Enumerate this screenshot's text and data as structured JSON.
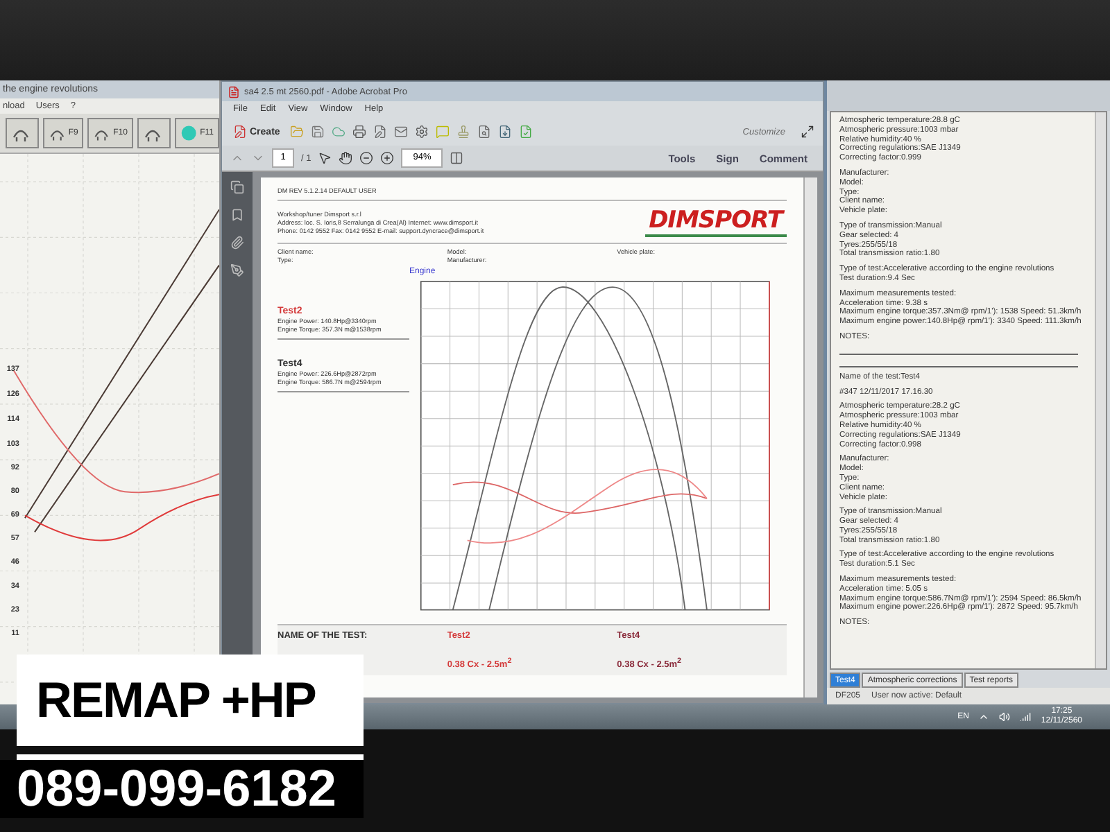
{
  "left_app": {
    "title": "the engine revolutions",
    "menu": [
      "nload",
      "Users",
      "?"
    ],
    "toolbar": [
      {
        "kind": "icon"
      },
      {
        "kind": "labeled",
        "label": "F9"
      },
      {
        "kind": "labeled",
        "label": "F10"
      },
      {
        "kind": "icon"
      },
      {
        "kind": "labeled",
        "label": "F11"
      }
    ],
    "y_ticks": [
      "137",
      "126",
      "114",
      "103",
      "92",
      "80",
      "69",
      "57",
      "46",
      "34",
      "23",
      "11"
    ]
  },
  "acrobat": {
    "title": "sa4 2.5 mt 2560.pdf - Adobe Acrobat Pro",
    "menu": [
      "File",
      "Edit",
      "View",
      "Window",
      "Help"
    ],
    "create": "Create",
    "customize": "Customize",
    "panels": [
      "Tools",
      "Sign",
      "Comment"
    ],
    "page": "1",
    "page_total": "/ 1",
    "zoom": "94%"
  },
  "document": {
    "header": "DM REV 5.1.2.14   DEFAULT USER",
    "workshop": [
      "Workshop/tuner Dimsport s.r.l",
      "Address: loc. S. Ioris,8 Serralunga di Crea(Al) Internet: www.dimsport.it",
      "Phone: 0142 9552 Fax: 0142 9552 E-mail: support.dyncrace@dimsport.it"
    ],
    "logo": "DIMSPORT",
    "info": [
      "Client name:",
      "Model:",
      "Vehicle plate:",
      "Type:",
      "Manufacturer:"
    ],
    "chart_title": "Engine",
    "tests": [
      {
        "name": "Test2",
        "color": "#d43a3a",
        "lines": [
          "Engine Power: 140.8Hp@3340rpm",
          "Engine Torque: 357.3N m@1538rpm"
        ]
      },
      {
        "name": "Test4",
        "color": "#333333",
        "lines": [
          "Engine Power: 226.6Hp@2872rpm",
          "Engine Torque: 586.7N m@2594rpm"
        ]
      }
    ],
    "table": {
      "label": "NAME OF THE TEST:",
      "tests": [
        {
          "name": "Test2",
          "value": "0.38 Cx - 2.5m$^{2}$",
          "color": "#d43a3a"
        },
        {
          "name": "Test4",
          "value": "0.38 Cx - 2.5m$^{2}$",
          "color": "#8a2a3a"
        }
      ]
    }
  },
  "report": {
    "blocks": [
      {
        "kind": "text",
        "lines": [
          "Atmospheric temperature:28.8 gC",
          "Atmospheric pressure:1003 mbar",
          "Relative humidity:40 %",
          "Correcting regulations:SAE J1349",
          "Correcting factor:0.999"
        ]
      },
      {
        "kind": "text",
        "lines": [
          "Manufacturer:",
          "Model:",
          "Type:",
          "Client name:",
          "Vehicle plate:"
        ]
      },
      {
        "kind": "text",
        "lines": [
          "Type of transmission:Manual",
          "Gear selected: 4",
          "Tyres:255/55/18",
          "Total transmission ratio:1.80"
        ]
      },
      {
        "kind": "text",
        "lines": [
          "Type of test:Accelerative according to the engine revolutions",
          "Test duration:9.4 Sec"
        ]
      },
      {
        "kind": "text",
        "lines": [
          "Maximum measurements tested:",
          "Acceleration time:  9.38 s",
          "Maximum engine torque:357.3Nm@ rpm/1'): 1538 Speed: 51.3km/h",
          "Maximum engine power:140.8Hp@ rpm/1'): 3340 Speed: 111.3km/h"
        ]
      },
      {
        "kind": "notes",
        "lines": [
          "NOTES:"
        ]
      },
      {
        "kind": "text",
        "lines": [
          "Name of the test:Test4"
        ]
      },
      {
        "kind": "text",
        "lines": [
          "#347    12/11/2017 17.16.30"
        ]
      },
      {
        "kind": "text",
        "lines": [
          "Atmospheric temperature:28.2 gC",
          "Atmospheric pressure:1003 mbar",
          "Relative humidity:40 %",
          "Correcting regulations:SAE J1349",
          "Correcting factor:0.998"
        ]
      },
      {
        "kind": "text",
        "lines": [
          "Manufacturer:",
          "Model:",
          "Type:",
          "Client name:",
          "Vehicle plate:"
        ]
      },
      {
        "kind": "text",
        "lines": [
          "Type of transmission:Manual",
          "Gear selected: 4",
          "Tyres:255/55/18",
          "Total transmission ratio:1.80"
        ]
      },
      {
        "kind": "text",
        "lines": [
          "Type of test:Accelerative according to the engine revolutions",
          "Test duration:5.1 Sec"
        ]
      },
      {
        "kind": "text",
        "lines": [
          "Maximum measurements tested:",
          "Acceleration time:  5.05 s",
          "Maximum engine torque:586.7Nm@ rpm/1'): 2594 Speed: 86.5km/h",
          "Maximum engine power:226.6Hp@ rpm/1'): 2872 Speed: 95.7km/h"
        ]
      },
      {
        "kind": "text",
        "lines": [
          "NOTES:"
        ]
      }
    ]
  },
  "tabs": [
    {
      "label": "Test4",
      "selected": true
    },
    {
      "label": "Atmospheric corrections",
      "selected": false
    },
    {
      "label": "Test reports",
      "selected": false
    }
  ],
  "status": [
    "DF205",
    "User now active: Default"
  ],
  "taskbar": {
    "language": "EN",
    "time": "17:25",
    "date": "12/11/2560"
  },
  "promo": {
    "headline": "REMAP +HP",
    "phone": "089-099-6182"
  }
}
